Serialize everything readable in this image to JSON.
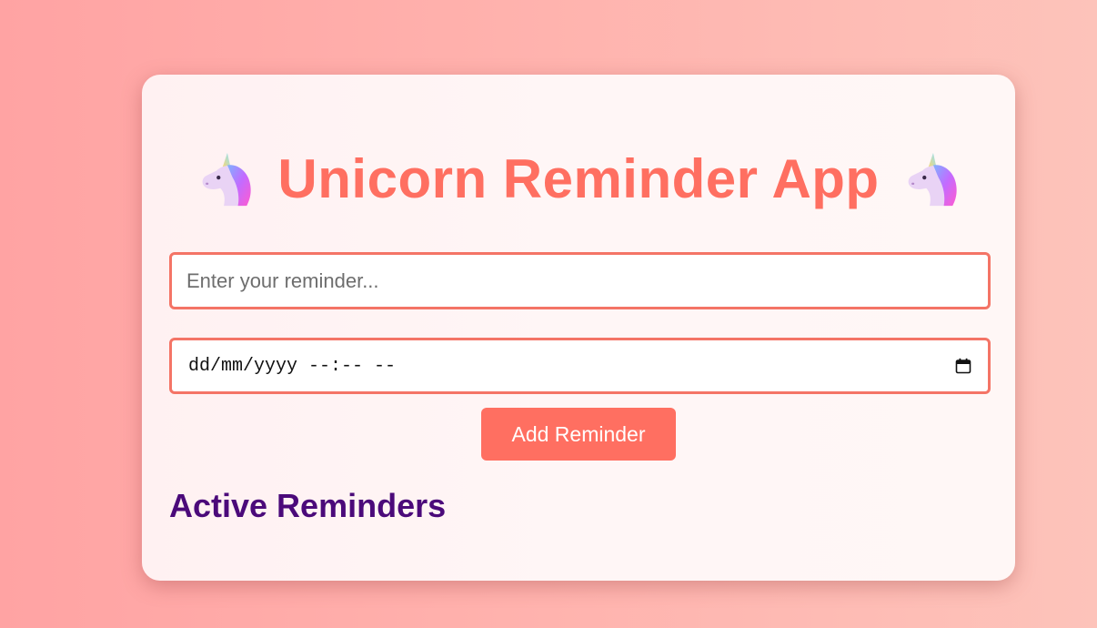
{
  "app": {
    "title": "Unicorn Reminder App",
    "title_icon": "unicorn-icon"
  },
  "form": {
    "reminder_placeholder": "Enter your reminder...",
    "reminder_value": "",
    "datetime_display": "dd/mm/yyyy --:-- --",
    "datetime_icon": "calendar-icon",
    "add_button_label": "Add Reminder"
  },
  "reminders": {
    "heading": "Active Reminders",
    "items": []
  },
  "colors": {
    "accent": "#ff6f61",
    "input_border": "#f47466",
    "heading": "#4b0a7a",
    "background_start": "#ffa3a3",
    "background_end": "#fdc3ba"
  }
}
